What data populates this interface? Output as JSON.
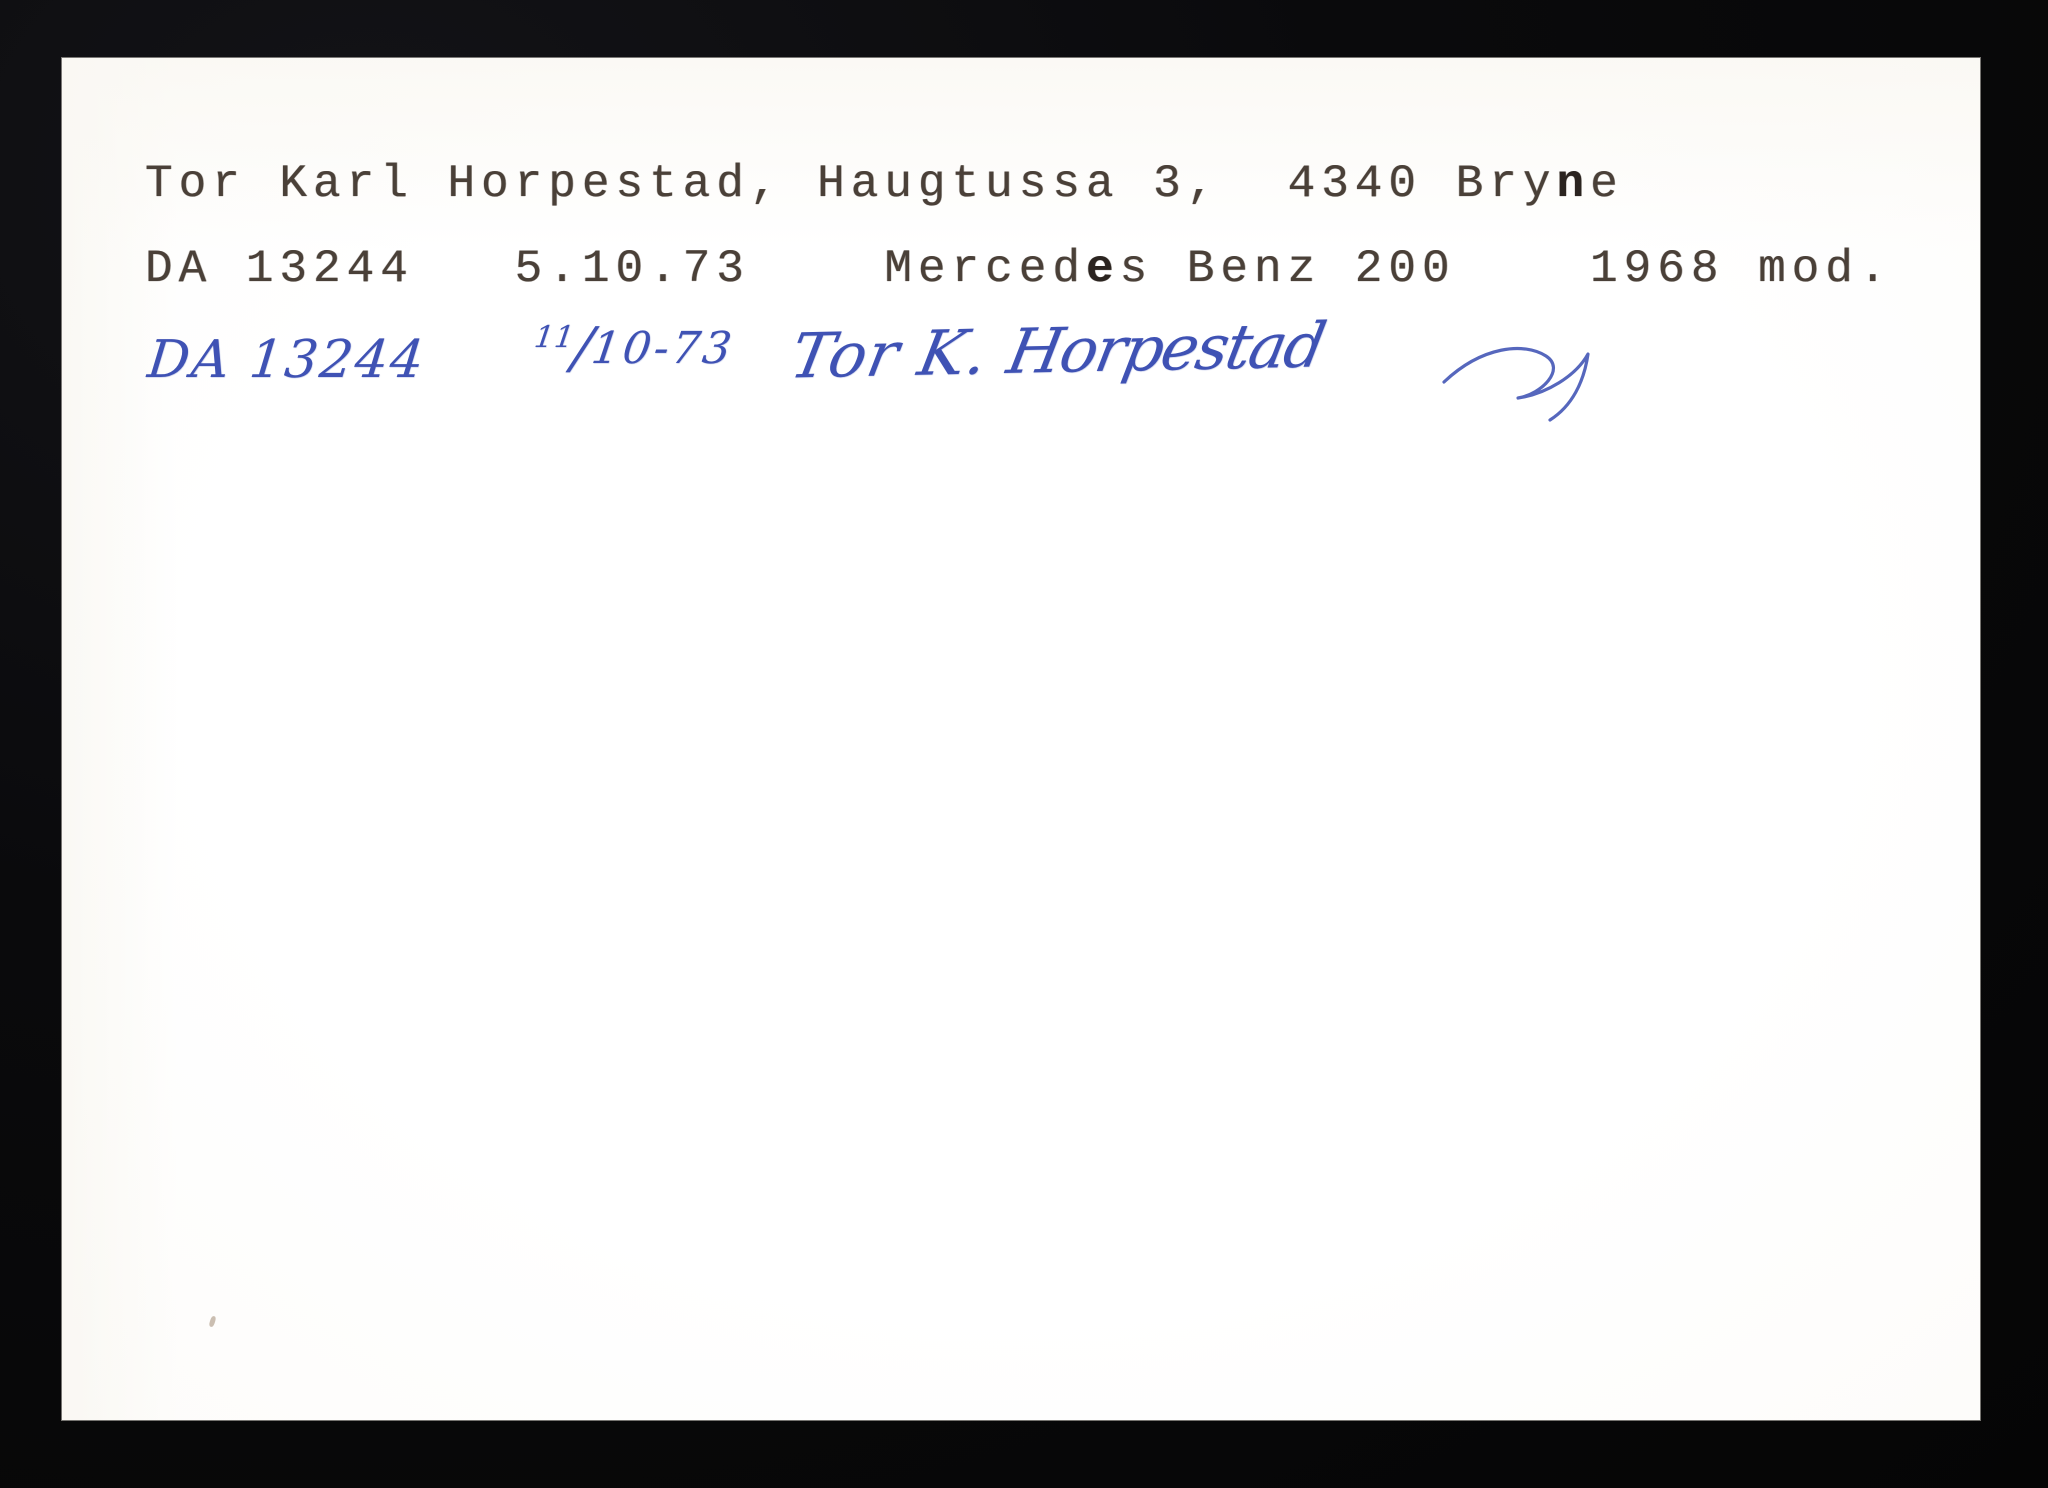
{
  "document": {
    "kind": "scanned-index-card",
    "background_color": "#070707",
    "card_color": "#ffffff"
  },
  "card": {
    "typed": {
      "ink_color": "#4a4038",
      "line1": {
        "owner_name": "Tor Karl Horpestad",
        "separator1": ", ",
        "street_address": "Haugtussa 3",
        "separator2": ",  ",
        "postal_code": "4340",
        "city_prefix": "Bry",
        "city_overstrike": "n",
        "city_suffix": "e",
        "full_text": "Tor Karl Horpestad, Haugtussa 3,  4340 Bryne"
      },
      "line2": {
        "registration_number": "DA 13244",
        "gap1": "   ",
        "date": "5.10.73",
        "gap2": "    ",
        "make_prefix": "Merced",
        "make_overstrike": "e",
        "make_suffix": "s Benz 200",
        "gap3": "    ",
        "model_year": "1968 mod.",
        "full_text": "DA 13244   5.10.73    Mercedes Benz 200    1968 mod."
      }
    },
    "handwritten": {
      "ink_color": "#3f52b4",
      "registration_number": "DA 13244",
      "date_day": "11",
      "date_slash": "/",
      "date_month_year": "10-73",
      "date_full": "11/10-73",
      "signature_first": "Tor K.",
      "signature_surname": "Horpestad",
      "signature_full": "Tor K. Horpestad"
    }
  }
}
